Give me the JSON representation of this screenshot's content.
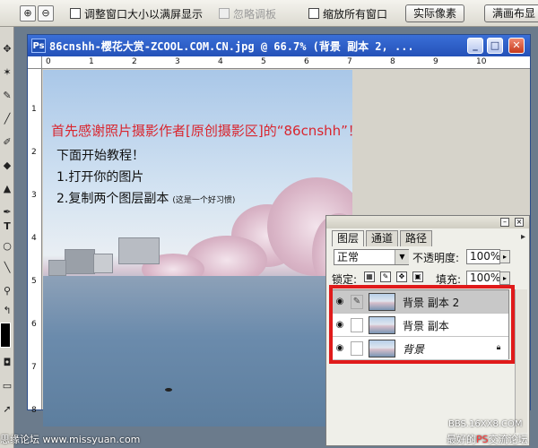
{
  "options_bar": {
    "zoom_in_icon": "zoom-in-icon",
    "zoom_out_icon": "zoom-out-icon",
    "resize_windows_label": "调整窗口大小以满屏显示",
    "ignore_palettes_label": "忽略调板",
    "zoom_all_windows_label": "缩放所有窗口",
    "actual_pixels_label": "实际像素",
    "fill_screen_label": "满画布显"
  },
  "document": {
    "title": "86cnshh-樱花大赏-ZCOOL.COM.CN.jpg @ 66.7% (背景 副本 2, ...",
    "ruler_top_ticks": [
      "0",
      "1",
      "2",
      "3",
      "4",
      "5",
      "6",
      "7",
      "8",
      "9",
      "10"
    ],
    "ruler_left_ticks": [
      "1",
      "2",
      "3",
      "4",
      "5",
      "6",
      "7",
      "8"
    ]
  },
  "tutorial": {
    "title": "首先感谢照片摄影作者[原创摄影区]的“86cnshh”！",
    "line1": "下面开始教程！",
    "line2": "1.打开你的图片",
    "line3": "2.复制两个图层副本",
    "line3_note": "(这是一个好习惯)"
  },
  "layers_panel": {
    "tabs": [
      "图层",
      "通道",
      "路径"
    ],
    "blend_mode": "正常",
    "opacity_label": "不透明度:",
    "opacity_value": "100%",
    "lock_label": "锁定:",
    "fill_label": "填充:",
    "fill_value": "100%",
    "layers": [
      {
        "name": "背景 副本 2",
        "selected": true
      },
      {
        "name": "背景 副本",
        "selected": false
      },
      {
        "name": "背景",
        "selected": false
      }
    ]
  },
  "watermarks": {
    "left": "思缘论坛 www.missyuan.com",
    "right_top": "BBS.16XX8.COM",
    "right_bottom_prefix": "最好的",
    "right_bottom_ps": "PS",
    "right_bottom_suffix": "交流论坛"
  },
  "colors": {
    "titlebar": "#2451b8",
    "highlight_box": "#e01a1a",
    "tutorial_title": "#d9262f"
  }
}
